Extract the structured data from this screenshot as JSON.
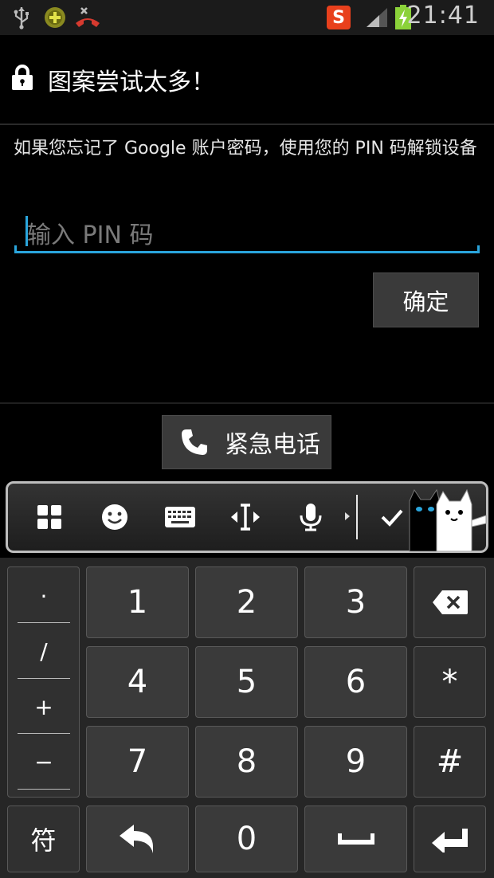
{
  "status_bar": {
    "time": "21:41",
    "icons": [
      "usb-icon",
      "app-update-icon",
      "missed-call-icon",
      "sogou-input-icon",
      "signal-icon",
      "battery-charging-icon"
    ],
    "sogou_letter": "S"
  },
  "dialog": {
    "title": "图案尝试太多！",
    "message": "如果您忘记了 Google 账户密码，使用您的 PIN 码解锁设备",
    "pin_placeholder": "输入 PIN 码",
    "ok_label": "确定",
    "emergency_label": "紧急电话"
  },
  "keyboard_toolbar": {
    "icons": [
      "grid-menu-icon",
      "emoji-icon",
      "keyboard-icon",
      "cursor-move-icon",
      "microphone-icon",
      "check-icon"
    ]
  },
  "keypad": {
    "symbols": [
      "·",
      "/",
      "+",
      "−"
    ],
    "digits": [
      "1",
      "2",
      "3",
      "4",
      "5",
      "6",
      "7",
      "8",
      "9",
      "0"
    ],
    "star": "*",
    "hash": "#",
    "symbol_switch": "符"
  },
  "colors": {
    "accent": "#2aa5dc",
    "sogou": "#e8401c",
    "battery": "#8bd23a"
  }
}
